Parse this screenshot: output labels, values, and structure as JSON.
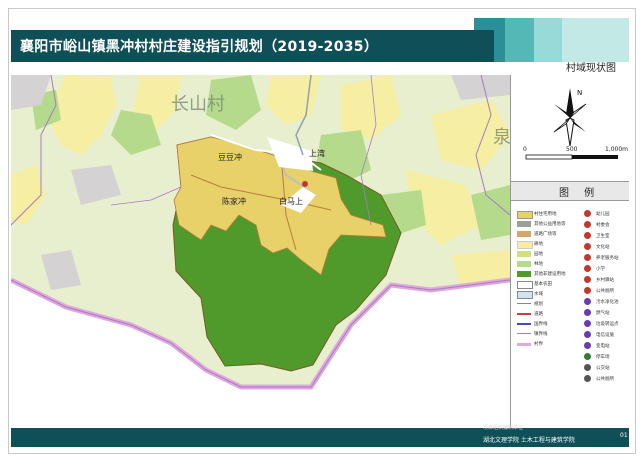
{
  "title": "襄阳市峪山镇黑冲村村庄建设指引规划（2019-2035）",
  "subtitle": "村域现状图",
  "scale": {
    "zero": "0",
    "mid": "500",
    "end": "1,000m"
  },
  "legend_title": "图 例",
  "map_labels": {
    "neighbor_village": "长山村",
    "neighbor_partial": "泉",
    "place_doudouchong": "豆豆冲",
    "place_shangwan": "上湾",
    "place_chenjiachong": "陈家冲",
    "place_shangshang": "白马上"
  },
  "legend_left": [
    "村住宅用地",
    "其他公益用地等",
    "道路广场等",
    "耕地",
    "园地",
    "林地",
    "其他非建设用地",
    "基本农田",
    "水域",
    "规划",
    "道路",
    "国界线",
    "镇界线",
    "村界"
  ],
  "legend_right": [
    "幼儿园",
    "村委会",
    "卫生室",
    "文化站",
    "养老服务站",
    "小学",
    "乡村驿站",
    "公共厕所",
    "污水净化池",
    "燃气站",
    "垃圾转运点",
    "电信设施",
    "变电站",
    "停车场",
    "公交站",
    "公共厕所"
  ],
  "footer_line1": "项目组织编制单位",
  "footer_line2": "湖北文理学院 土木工程与建筑学院",
  "page_number": "01",
  "colors": {
    "header": "#0f4f57",
    "village_core": "#e9d16a",
    "forest": "#4f9a2b",
    "boundary": "#e0a8dc"
  }
}
